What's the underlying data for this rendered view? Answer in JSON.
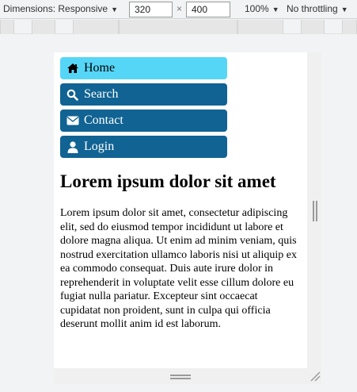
{
  "toolbar": {
    "dimensions_label": "Dimensions: Responsive",
    "width_value": "320",
    "times": "×",
    "height_value": "400",
    "zoom": "100%",
    "throttling": "No throttling"
  },
  "page": {
    "nav": [
      {
        "label": "Home",
        "icon": "home-icon",
        "active": true
      },
      {
        "label": "Search",
        "icon": "search-icon",
        "active": false
      },
      {
        "label": "Contact",
        "icon": "envelope-icon",
        "active": false
      },
      {
        "label": "Login",
        "icon": "user-icon",
        "active": false
      }
    ],
    "title": "Lorem ipsum dolor sit amet",
    "paragraph": "Lorem ipsum dolor sit amet, consectetur adipiscing elit, sed do eiusmod tempor incididunt ut labore et dolore magna aliqua. Ut enim ad minim veniam, quis nostrud exercitation ullamco laboris nisi ut aliquip ex ea commodo consequat. Duis aute irure dolor in reprehenderit in voluptate velit esse cillum dolore eu fugiat nulla pariatur. Excepteur sint occaecat cupidatat non proident, sunt in culpa qui officia deserunt mollit anim id est laborum."
  },
  "colors": {
    "nav_active": "#56d6f7",
    "nav_default": "#106393"
  }
}
